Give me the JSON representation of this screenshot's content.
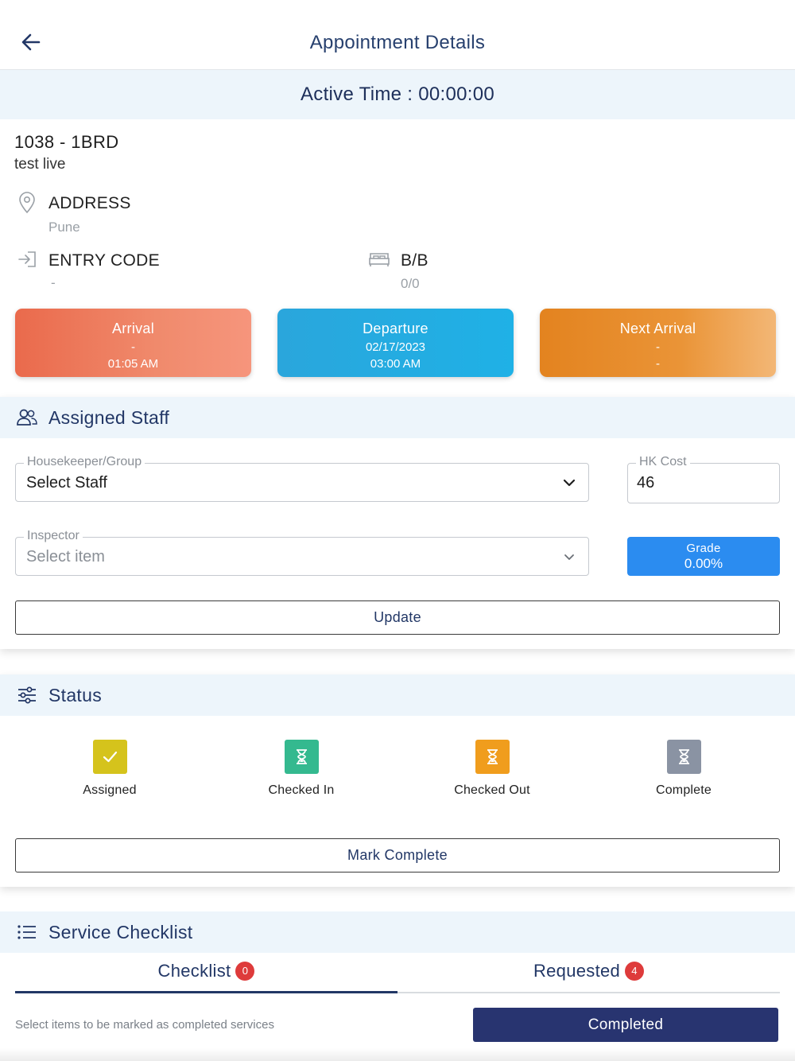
{
  "header": {
    "title": "Appointment Details",
    "back_icon": "arrow-left-icon"
  },
  "active_time": "Active Time : 00:00:00",
  "unit": {
    "title": "1038 - 1BRD",
    "subtitle": "test live"
  },
  "address": {
    "label": "ADDRESS",
    "value": "Pune",
    "icon": "location-pin-icon"
  },
  "entry_code": {
    "label": "ENTRY CODE",
    "value": "-",
    "icon": "sign-in-icon"
  },
  "beds": {
    "label": "B/B",
    "value": "0/0",
    "icon": "bed-icon"
  },
  "date_cards": {
    "arrival": {
      "title": "Arrival",
      "line1": "-",
      "line2": "01:05 AM"
    },
    "departure": {
      "title": "Departure",
      "line1": "02/17/2023",
      "line2": "03:00 AM"
    },
    "next_arrival": {
      "title": "Next Arrival",
      "line1": "-",
      "line2": "-"
    }
  },
  "assigned_staff": {
    "title": "Assigned Staff",
    "icon": "users-icon",
    "housekeeper": {
      "legend": "Housekeeper/Group",
      "value": "Select Staff"
    },
    "hk_cost": {
      "legend": "HK Cost",
      "value": "46"
    },
    "inspector": {
      "legend": "Inspector",
      "placeholder": "Select item"
    },
    "grade": {
      "label": "Grade",
      "value": "0.00%"
    },
    "update_label": "Update"
  },
  "status": {
    "title": "Status",
    "icon": "sliders-icon",
    "items": [
      {
        "label": "Assigned",
        "icon": "check-icon",
        "color": "#d5c31c"
      },
      {
        "label": "Checked In",
        "icon": "hourglass-icon",
        "color": "#34b98f"
      },
      {
        "label": "Checked Out",
        "icon": "hourglass-icon",
        "color": "#f09d1d"
      },
      {
        "label": "Complete",
        "icon": "hourglass-icon",
        "color": "#8a93a3"
      }
    ],
    "mark_complete_label": "Mark Complete"
  },
  "service_checklist": {
    "title": "Service Checklist",
    "icon": "list-icon",
    "tabs": [
      {
        "label": "Checklist",
        "badge": "0"
      },
      {
        "label": "Requested",
        "badge": "4"
      }
    ],
    "hint": "Select items to be marked as completed services",
    "completed_label": "Completed"
  },
  "colors": {
    "primary": "#223766",
    "accent_blue": "#2b8cf0",
    "header_band": "#edf5fb",
    "badge_red": "#de3b3b",
    "completed_button": "#283470"
  }
}
